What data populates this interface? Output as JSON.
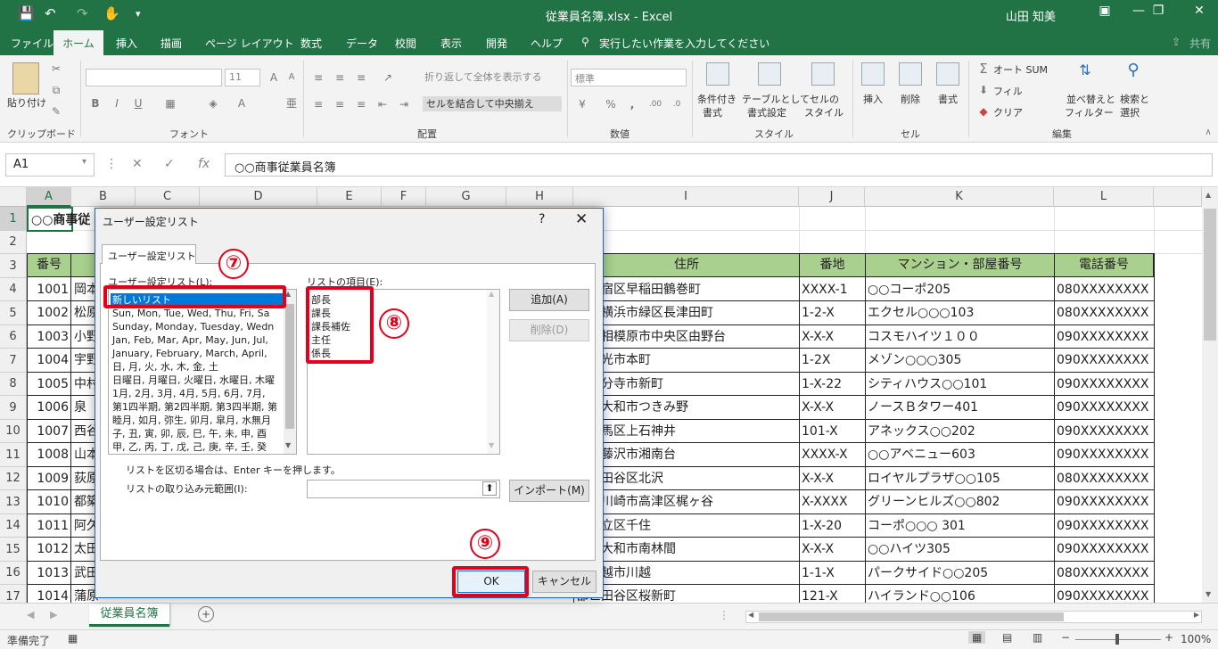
{
  "titlebar": {
    "title": "従業員名簿.xlsx - Excel",
    "user": "山田 知美"
  },
  "tabs": [
    "ファイル",
    "ホーム",
    "挿入",
    "描画",
    "ページ レイアウト",
    "数式",
    "データ",
    "校閲",
    "表示",
    "開発",
    "ヘルプ"
  ],
  "tell_me": "実行したい作業を入力してください",
  "share": "共有",
  "ribbon": {
    "clipboard": {
      "paste": "貼り付け",
      "label": "クリップボード"
    },
    "font": {
      "size": "11",
      "label": "フォント"
    },
    "alignment": {
      "wrap": "折り返して全体を表示する",
      "merge": "セルを結合して中央揃え",
      "label": "配置"
    },
    "number": {
      "format": "標準",
      "label": "数値"
    },
    "styles": {
      "conditional": "条件付き",
      "conditional2": "書式",
      "table": "テーブルとして",
      "table2": "書式設定",
      "cell": "セルの",
      "cell2": "スタイル",
      "label": "スタイル"
    },
    "cells": {
      "insert": "挿入",
      "delete": "削除",
      "format": "書式",
      "label": "セル"
    },
    "editing": {
      "autosum": "オート SUM",
      "fill": "フィル",
      "clear": "クリア",
      "sort": "並べ替えと",
      "sort2": "フィルター",
      "find": "検索と",
      "find2": "選択",
      "label": "編集"
    }
  },
  "formula_bar": {
    "name_box": "A1",
    "formula": "○○商事従業員名簿"
  },
  "grid": {
    "columns": [
      "A",
      "B",
      "C",
      "D",
      "E",
      "F",
      "G",
      "H",
      "I",
      "J",
      "K",
      "L"
    ],
    "rows": [
      "1",
      "2",
      "3",
      "4",
      "5",
      "6",
      "7",
      "8",
      "9",
      "10",
      "11",
      "12",
      "13",
      "14",
      "15",
      "16",
      "17"
    ],
    "a1": "○○商事従",
    "header": {
      "no": "番号",
      "address": "住所",
      "banchi": "番地",
      "mansion": "マンション・部屋番号",
      "phone": "電話番号"
    },
    "data": [
      {
        "no": "1001",
        "name": "岡本",
        "addr": "都新宿区早稲田鶴巻町",
        "banchi": "XXXX-1",
        "mansion": "○○コーポ205",
        "phone": "080XXXXXXXX"
      },
      {
        "no": "1002",
        "name": "松原",
        "addr": "川県横浜市緑区長津田町",
        "banchi": "1-2-X",
        "mansion": "エクセル○○○103",
        "phone": "080XXXXXXXX"
      },
      {
        "no": "1003",
        "name": "小野",
        "addr": "川県相模原市中央区由野台",
        "banchi": "X-X-X",
        "mansion": "コスモハイツ１００",
        "phone": "090XXXXXXXX"
      },
      {
        "no": "1004",
        "name": "宇野",
        "addr": "県和光市本町",
        "banchi": "1-2X",
        "mansion": "メゾン○○○305",
        "phone": "090XXXXXXXX"
      },
      {
        "no": "1005",
        "name": "中村",
        "addr": "都国分寺市新町",
        "banchi": "1-X-22",
        "mansion": "シティハウス○○101",
        "phone": "090XXXXXXXX"
      },
      {
        "no": "1006",
        "name": "泉",
        "addr": "川県大和市つきみ野",
        "banchi": "X-X-X",
        "mansion": "ノースＢタワー401",
        "phone": "090XXXXXXXX"
      },
      {
        "no": "1007",
        "name": "西谷",
        "addr": "都練馬区上石神井",
        "banchi": "101-X",
        "mansion": "アネックス○○202",
        "phone": "090XXXXXXXX"
      },
      {
        "no": "1008",
        "name": "山本",
        "addr": "川県藤沢市湘南台",
        "banchi": "XXXX-X",
        "mansion": "○○アベニュー603",
        "phone": "090XXXXXXXX"
      },
      {
        "no": "1009",
        "name": "荻原",
        "addr": "都世田谷区北沢",
        "banchi": "X-X-X",
        "mansion": "ロイヤルプラザ○○105",
        "phone": "080XXXXXXXX"
      },
      {
        "no": "1010",
        "name": "都築",
        "addr": "川県川崎市高津区梶ヶ谷",
        "banchi": "X-XXXX",
        "mansion": "グリーンヒルズ○○802",
        "phone": "090XXXXXXXX"
      },
      {
        "no": "1011",
        "name": "阿久",
        "addr": "都足立区千住",
        "banchi": "1-X-20",
        "mansion": "コーポ○○○ 301",
        "phone": "090XXXXXXXX"
      },
      {
        "no": "1012",
        "name": "太田",
        "addr": "川県大和市南林間",
        "banchi": "X-X-X",
        "mansion": "○○ハイツ305",
        "phone": "090XXXXXXXX"
      },
      {
        "no": "1013",
        "name": "武田",
        "addr": "県川越市川越",
        "banchi": "1-1-X",
        "mansion": "パークサイド○○205",
        "phone": "080XXXXXXXX"
      },
      {
        "no": "1014",
        "name": "蒲原",
        "addr": "都世田谷区桜新町",
        "banchi": "121-X",
        "mansion": "ハイランド○○106",
        "phone": "090XXXXXXXX"
      }
    ]
  },
  "sheet_tab": "従業員名簿",
  "status": "準備完了",
  "zoom": "100%",
  "dialog": {
    "title": "ユーザー設定リスト",
    "help": "?",
    "close": "✕",
    "tab": "ユーザー設定リスト",
    "left_label": "ユーザー設定リスト(L):",
    "right_label": "リストの項目(E):",
    "lists": [
      "新しいリスト",
      "Sun, Mon, Tue, Wed, Thu, Fri, Sa",
      "Sunday, Monday, Tuesday, Wedn",
      "Jan, Feb, Mar, Apr, May, Jun, Jul,",
      "January, February, March, April,",
      "日, 月, 火, 水, 木, 金, 土",
      "日曜日, 月曜日, 火曜日, 水曜日, 木曜",
      "1月, 2月, 3月, 4月, 5月, 6月, 7月,",
      "第1四半期, 第2四半期, 第3四半期, 第",
      "睦月, 如月, 弥生, 卯月, 皐月, 水無月",
      "子, 丑, 寅, 卯, 辰, 巳, 午, 未, 申, 酉",
      "甲, 乙, 丙, 丁, 戊, 己, 庚, 辛, 壬, 癸"
    ],
    "items": [
      "部長",
      "課長",
      "課長補佐",
      "主任",
      "係長"
    ],
    "add_btn": "追加(A)",
    "delete_btn": "削除(D)",
    "hint": "リストを区切る場合は、Enter キーを押します。",
    "import_label": "リストの取り込み元範囲(I):",
    "import_btn": "インポート(M)",
    "ok": "OK",
    "cancel": "キャンセル"
  },
  "callouts": [
    "⑦",
    "⑧",
    "⑨"
  ],
  "colors": {
    "excel_green": "#217346",
    "header_fill": "#a9d08e",
    "highlight_red": "#e4001b",
    "selection_blue": "#0078d7"
  }
}
